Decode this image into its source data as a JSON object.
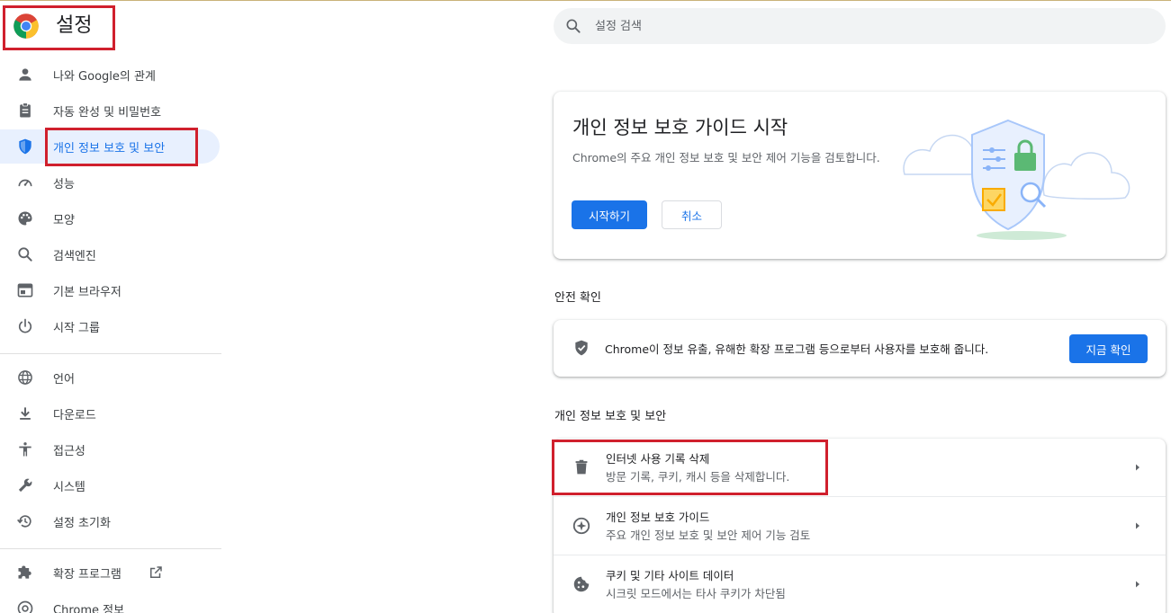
{
  "app": {
    "title": "설정"
  },
  "search": {
    "placeholder": "설정 검색"
  },
  "sidebar": {
    "items": [
      {
        "label": "나와 Google의 관계",
        "icon": "person-icon"
      },
      {
        "label": "자동 완성 및 비밀번호",
        "icon": "clipboard-icon"
      },
      {
        "label": "개인 정보 보호 및 보안",
        "icon": "shield-icon",
        "active": true
      },
      {
        "label": "성능",
        "icon": "speedometer-icon"
      },
      {
        "label": "모양",
        "icon": "palette-icon"
      },
      {
        "label": "검색엔진",
        "icon": "search-icon"
      },
      {
        "label": "기본 브라우저",
        "icon": "browser-icon"
      },
      {
        "label": "시작 그룹",
        "icon": "power-icon"
      },
      {
        "label": "언어",
        "icon": "globe-icon"
      },
      {
        "label": "다운로드",
        "icon": "download-icon"
      },
      {
        "label": "접근성",
        "icon": "accessibility-icon"
      },
      {
        "label": "시스템",
        "icon": "wrench-icon"
      },
      {
        "label": "설정 초기화",
        "icon": "restore-icon"
      },
      {
        "label": "확장 프로그램",
        "icon": "puzzle-icon"
      },
      {
        "label": "Chrome 정보",
        "icon": "chrome-icon"
      }
    ]
  },
  "guide_card": {
    "title": "개인 정보 보호 가이드 시작",
    "description": "Chrome의 주요 개인 정보 보호 및 보안 제어 기능을 검토합니다.",
    "start_label": "시작하기",
    "cancel_label": "취소"
  },
  "safety_check": {
    "section_title": "안전 확인",
    "text": "Chrome이 정보 유출, 유해한 확장 프로그램 등으로부터 사용자를 보호해 줍니다.",
    "button_label": "지금 확인"
  },
  "privacy_section": {
    "section_title": "개인 정보 보호 및 보안",
    "rows": [
      {
        "title": "인터넷 사용 기록 삭제",
        "subtitle": "방문 기록, 쿠키, 캐시 등을 삭제합니다.",
        "icon": "trash-icon"
      },
      {
        "title": "개인 정보 보호 가이드",
        "subtitle": "주요 개인 정보 보호 및 보안 제어 기능 검토",
        "icon": "compass-icon"
      },
      {
        "title": "쿠키 및 기타 사이트 데이터",
        "subtitle": "시크릿 모드에서는 타사 쿠키가 차단됨",
        "icon": "cookie-icon"
      }
    ]
  },
  "colors": {
    "accent": "#1a73e8",
    "highlight_border": "#d0202d",
    "active_bg": "#e8f0fe"
  }
}
